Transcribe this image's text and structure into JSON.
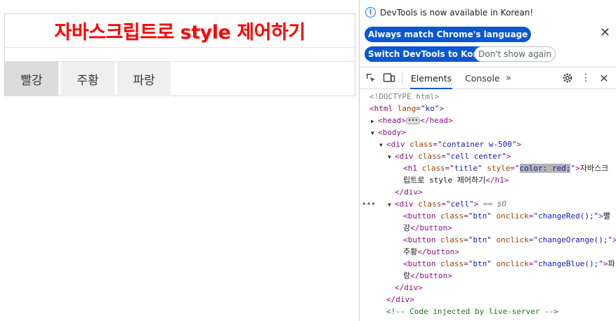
{
  "page": {
    "title": "자바스크립트로 style 제어하기",
    "title_color": "#ff0000",
    "buttons": [
      "빨강",
      "주황",
      "파랑"
    ]
  },
  "devtools": {
    "info_message": "DevTools is now available in Korean!",
    "btn_match_language": "Always match Chrome's language",
    "btn_switch_korean": "Switch DevTools to Korean",
    "btn_dont_show": "Don't show again",
    "tabs": {
      "elements": "Elements",
      "console": "Console",
      "more": "»"
    },
    "accent_color": "#0b57d0",
    "dom": {
      "doctype": "<!DOCTYPE html>",
      "html_tag": "<html",
      "html_attr": "lang",
      "html_val": "\"ko\"",
      "head_open": "<head>",
      "head_close": "</head>",
      "body_open": "<body>",
      "div_container_attr_val": "\"container w-500\"",
      "div_cell_center_val": "\"cell center\"",
      "h1_class_val": "\"title\"",
      "h1_style_val": "color: red;",
      "h1_text_1": "자바스크",
      "h1_text_2": "립트로 style 제어하기",
      "h1_close": "</h1>",
      "div_close": "</div>",
      "div_cell_val": "\"cell\"",
      "selected_marker": "== $0",
      "btn1_onclick": "\"changeRed();\"",
      "btn1_text_a": "빨",
      "btn1_text_b": "강",
      "btn2_onclick": "\"changeOrange();\"",
      "btn2_text": "주황",
      "btn3_onclick": "\"changeBlue();\"",
      "btn3_text_a": "파",
      "btn3_text_b": "랑",
      "btn_class_val": "\"btn\"",
      "button_close": "</button>",
      "comment": "<!-- Code injected by live-server -->"
    }
  }
}
